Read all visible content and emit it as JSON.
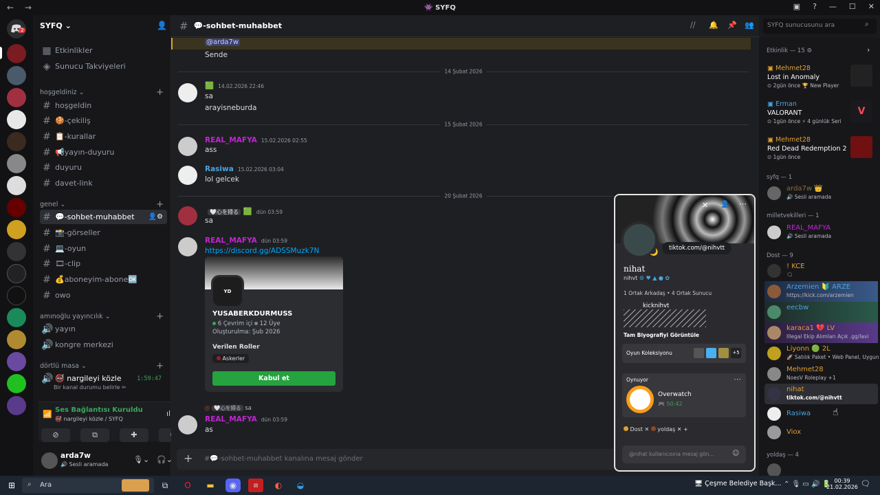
{
  "window": {
    "title": "SYFQ"
  },
  "server": {
    "name": "SYFQ",
    "unread_badge": "2"
  },
  "sidebar": {
    "top_items": [
      {
        "icon": "calendar-icon",
        "label": "Etkinlikler"
      },
      {
        "icon": "boost-icon",
        "label": "Sunucu Takviyeleri"
      }
    ],
    "categories": [
      {
        "label": "hoşgeldiniz",
        "channels": [
          "hoşgeldin",
          "🍪-çekiliş",
          "📋-kurallar",
          "📢yayın-duyuru",
          "duyuru",
          "davet-link"
        ]
      },
      {
        "label": "genel",
        "channels": [
          "💬-sohbet-muhabbet",
          "📸-görseller",
          "💻-oyun",
          "🎞-clip",
          "💰aboneyim-abone🆗",
          "owo"
        ]
      },
      {
        "label": "amınoğlu yayıncılık",
        "channels": [
          "yayın",
          "kongre merkezi"
        ]
      },
      {
        "label": "dörtlü masa",
        "channels": [
          "🚭 nargileyi közle"
        ]
      }
    ],
    "voice_channel": {
      "name": "🚭 nargileyi közle",
      "timer": "1:59:47",
      "status": "Bir kanal durumu belirle ✏"
    },
    "voice_panel": {
      "status": "Ses Bağlantısı Kuruldu",
      "channel": "🚭 nargileyi közle / SYFQ"
    },
    "user": {
      "name": "arda7w",
      "status": "Sesli aramada"
    }
  },
  "chat": {
    "channel": "💬-sohbet-muhabbet",
    "messages": [
      {
        "mention": "@arda7w",
        "text": "Sende"
      },
      {
        "divider": "14 Şubat 2026"
      },
      {
        "author": "",
        "time": "14.02.2026 22:46",
        "lines": [
          "sa",
          "arayisneburda"
        ],
        "color": "#8a4a2a"
      },
      {
        "divider": "15 Şubat 2026"
      },
      {
        "author": "REAL_MAFYA",
        "time": "15.02.2026 02:55",
        "lines": [
          "ass"
        ],
        "color": "#c026d3"
      },
      {
        "author": "Rasiwa",
        "time": "15.02.2026 03:04",
        "lines": [
          "lol gelcek"
        ],
        "color": "#4aa3df"
      },
      {
        "divider": "20 Şubat 2026"
      },
      {
        "author": "",
        "tag": "🤍心を掃る",
        "time": "dün 03:59",
        "lines": [
          "sa"
        ],
        "color": "#8a4a2a"
      },
      {
        "author": "REAL_MAFYA",
        "time": "dün 03:59",
        "lines": [
          "https://discord.gg/ADSSMuzk7N"
        ],
        "color": "#c026d3"
      },
      {
        "reply_tag": "🤍心を掃る",
        "reply_text": "sa",
        "author": "REAL_MAFYA",
        "time": "dün 03:59",
        "lines": [
          "as"
        ],
        "color": "#c026d3"
      }
    ],
    "invite": {
      "server": "YUSABERKDURMUSS",
      "online": "6 Çevrim içi",
      "members": "12 Üye",
      "created": "Oluşturulma: Şub 2026",
      "roles_title": "Verilen Roller",
      "role": "Askerler",
      "button": "Kabul et"
    },
    "composer_placeholder": "#💬-sohbet-muhabbet kanalına mesaj gönder"
  },
  "header": {
    "search_placeholder": "SYFQ sunucusunu ara"
  },
  "members": {
    "events_title": "Etkinlik — 15 ⚙",
    "activities": [
      {
        "name": "Mehmet28",
        "game": "Lost in Anomaly",
        "meta1": "2gün önce",
        "meta2": "New Player"
      },
      {
        "name": "Erman",
        "game": "VALORANT",
        "meta1": "1gün önce",
        "meta2": "4 günlük Seri"
      },
      {
        "name": "Mehmet28",
        "game": "Red Dead Redemption 2",
        "meta1": "1gün önce",
        "meta2": ""
      }
    ],
    "groups": [
      {
        "title": "syfq — 1",
        "members": [
          {
            "name": "arda7w 👑",
            "sub": "Sesli aramada",
            "color": "#8a6a3a"
          }
        ]
      },
      {
        "title": "milletvekilleri — 1",
        "members": [
          {
            "name": "REAL_MAFYA",
            "sub": "Sesli aramada",
            "color": "#c026d3"
          }
        ]
      },
      {
        "title": "Dost — 9",
        "members": [
          {
            "name": "! KCE",
            "sub": "🗨",
            "color": "#e0a030"
          },
          {
            "name": "Arzemien 🔰 ARZE",
            "sub": "https://kick.com/arzemien",
            "color": "#4aa3df"
          },
          {
            "name": "eecbw",
            "sub": "",
            "color": "#4aa3df"
          },
          {
            "name": "karaca1 💔 LV",
            "sub": "Illegal Ekip Alımları Açık .gg/lavi",
            "color": "#e0a030"
          },
          {
            "name": "Liyonn 🟢 2L",
            "sub": "🚀 Satılık Paket • Web Panel, Uygun",
            "color": "#e0a030"
          },
          {
            "name": "Mehmet28",
            "sub": "NoesV Roleplay +1",
            "color": "#e0a030"
          },
          {
            "name": "nihat",
            "sub": "tiktok.com/@nihvtt",
            "color": "#e0a030"
          },
          {
            "name": "Rasiwa",
            "sub": "",
            "color": "#4aa3df"
          },
          {
            "name": "Viox",
            "sub": "",
            "color": "#e0a030"
          }
        ]
      },
      {
        "title": "yoldaş — 4",
        "members": []
      }
    ]
  },
  "popout": {
    "status_bubble": "tiktok.com/@nihvtt",
    "display_name": "nihat",
    "username": "nihvt",
    "mutual": "1 Ortak Arkadaş • 4 Ortak Sunucu",
    "bio_title": "kicknihvt",
    "bio_link": "Tam Biyografiyi Görüntüle",
    "collection_label": "Oyun Koleksiyonu",
    "collection_more": "+5",
    "playing_label": "Oynuyor",
    "game": "Overwatch",
    "game_time": "50:42",
    "roles": [
      "Dost",
      "yoldaş"
    ],
    "message_placeholder": "@nihat kullanıcısına mesaj gön..."
  },
  "taskbar": {
    "search": "Ara",
    "app": "Çeşme Belediye Başk...",
    "time": "00:39",
    "date": "21.02.2026"
  }
}
